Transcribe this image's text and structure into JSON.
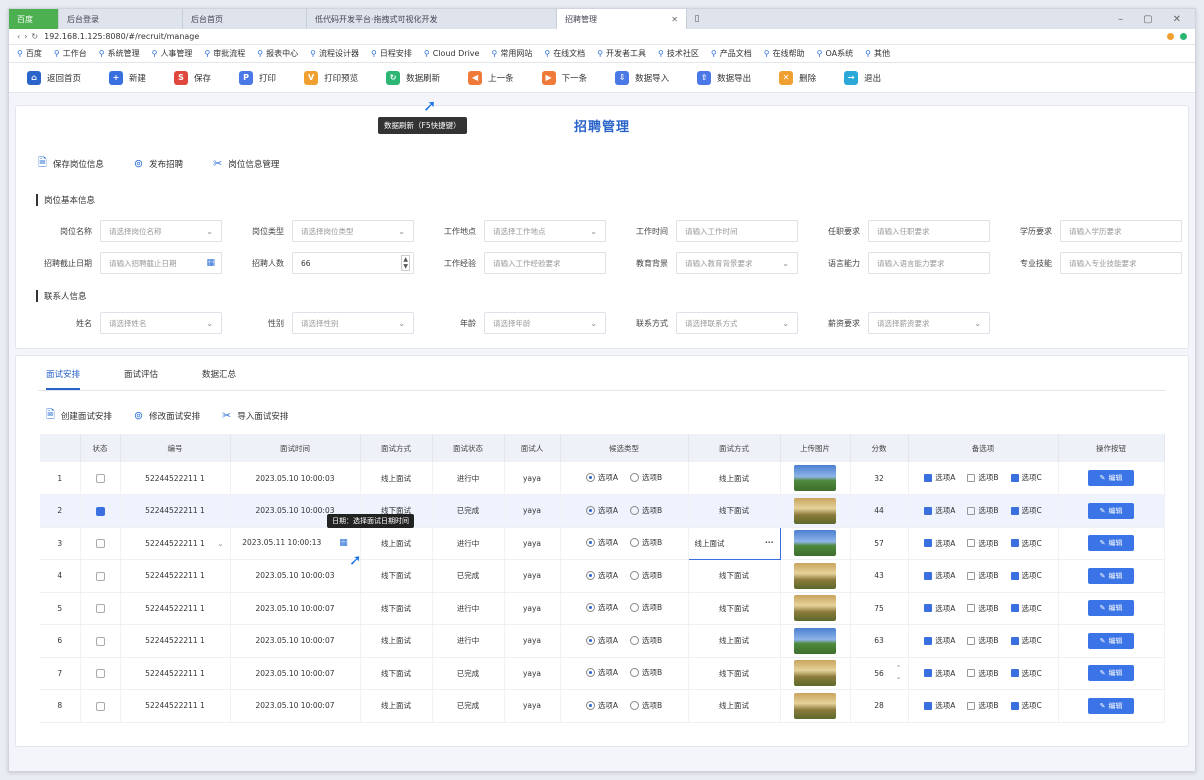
{
  "browser": {
    "tabs": [
      {
        "label": "百度",
        "cls": "first"
      },
      {
        "label": "后台登录",
        "cls": "w1"
      },
      {
        "label": "后台首页",
        "cls": "w2"
      },
      {
        "label": "低代码开发平台·拖拽式可视化开发",
        "cls": "w3"
      },
      {
        "label": "招聘管理",
        "cls": "active"
      }
    ],
    "url": "192.168.1.125:8080/#/recruit/manage",
    "bookmarks": [
      "百度",
      "工作台",
      "系统管理",
      "人事管理",
      "审批流程",
      "报表中心",
      "流程设计器",
      "日程安排",
      "Cloud Drive",
      "常用网站",
      "在线文档",
      "开发者工具",
      "技术社区",
      "产品文档",
      "在线帮助",
      "OA系统",
      "其他"
    ]
  },
  "toolbar": {
    "items": [
      {
        "label": "返回首页",
        "color": "#2a63c9",
        "glyph": "⌂",
        "name": "home"
      },
      {
        "label": "新建",
        "color": "#3a6fe0",
        "glyph": "+",
        "name": "new"
      },
      {
        "label": "保存",
        "color": "#e0483e",
        "glyph": "S",
        "name": "save"
      },
      {
        "label": "打印",
        "color": "#4a78e6",
        "glyph": "P",
        "name": "print"
      },
      {
        "label": "打印预览",
        "color": "#f0a030",
        "glyph": "V",
        "name": "preview"
      },
      {
        "label": "数据刷新",
        "color": "#2bb673",
        "glyph": "↻",
        "name": "refresh"
      },
      {
        "label": "上一条",
        "color": "#f07a3a",
        "glyph": "◀",
        "name": "prev"
      },
      {
        "label": "下一条",
        "color": "#f07a3a",
        "glyph": "▶",
        "name": "next"
      },
      {
        "label": "数据导入",
        "color": "#4a78e6",
        "glyph": "⇩",
        "name": "import"
      },
      {
        "label": "数据导出",
        "color": "#4a78e6",
        "glyph": "⇧",
        "name": "export"
      },
      {
        "label": "删除",
        "color": "#f0a030",
        "glyph": "✕",
        "name": "delete"
      },
      {
        "label": "退出",
        "color": "#2aa8d8",
        "glyph": "→",
        "name": "exit"
      }
    ],
    "tooltip": "数据刷新（F5快捷键）"
  },
  "form": {
    "title": "招聘管理",
    "actions": [
      "保存岗位信息",
      "发布招聘",
      "岗位信息管理"
    ],
    "section1": "岗位基本信息",
    "row1": [
      {
        "label": "岗位名称",
        "value": "请选择岗位名称",
        "kind": "select"
      },
      {
        "label": "岗位类型",
        "value": "请选择岗位类型",
        "kind": "select"
      },
      {
        "label": "工作地点",
        "value": "请选择工作地点",
        "kind": "select"
      },
      {
        "label": "工作时间",
        "value": "请输入工作时间",
        "kind": "input"
      },
      {
        "label": "任职要求",
        "value": "请输入任职要求",
        "kind": "input"
      },
      {
        "label": "学历要求",
        "value": "请输入学历要求",
        "kind": "input"
      }
    ],
    "row2": [
      {
        "label": "招聘截止日期",
        "value": "请输入招聘截止日期",
        "kind": "date"
      },
      {
        "label": "招聘人数",
        "value": "66",
        "kind": "number"
      },
      {
        "label": "工作经验",
        "value": "请输入工作经验要求",
        "kind": "input"
      },
      {
        "label": "教育背景",
        "value": "请输入教育背景要求",
        "kind": "select"
      },
      {
        "label": "语言能力",
        "value": "请输入语言能力要求",
        "kind": "input"
      },
      {
        "label": "专业技能",
        "value": "请输入专业技能要求",
        "kind": "input"
      }
    ],
    "section2": "联系人信息",
    "row3": [
      {
        "label": "姓名",
        "value": "请选择姓名",
        "kind": "select"
      },
      {
        "label": "性别",
        "value": "请选择性别",
        "kind": "select"
      },
      {
        "label": "年龄",
        "value": "请选择年龄",
        "kind": "select"
      },
      {
        "label": "联系方式",
        "value": "请选择联系方式",
        "kind": "select"
      },
      {
        "label": "薪资要求",
        "value": "请选择薪资要求",
        "kind": "select"
      }
    ]
  },
  "table": {
    "tabs": [
      "面试安排",
      "面试评估",
      "数据汇总"
    ],
    "actions": [
      "创建面试安排",
      "修改面试安排",
      "导入面试安排"
    ],
    "columns": [
      "",
      "状态",
      "编号",
      "面试时间",
      "面试方式",
      "面试状态",
      "面试人",
      "候选类型",
      "面试方式",
      "上传图片",
      "分数",
      "备选项",
      "操作按钮"
    ],
    "rows": [
      {
        "idx": "1",
        "checked": false,
        "id": "52244522211 1",
        "time": "2023.05.10 10:00:03",
        "mode": "线上面试",
        "status": "进行中",
        "person": "yaya",
        "radio": "a",
        "mode2": "线上面试",
        "score": "32",
        "opts": [
          true,
          false,
          true
        ],
        "img": "a",
        "sel": false
      },
      {
        "idx": "2",
        "checked": true,
        "id": "52244522211 1",
        "time": "2023.05.10 10:00:03",
        "mode": "线下面试",
        "status": "已完成",
        "person": "yaya",
        "radio": "a",
        "mode2": "线下面试",
        "score": "44",
        "opts": [
          true,
          false,
          true
        ],
        "img": "b",
        "sel": true
      },
      {
        "idx": "3",
        "checked": false,
        "id": "52244522211 1",
        "time": "2023.05.11 10:00:13",
        "mode": "线上面试",
        "status": "进行中",
        "person": "yaya",
        "radio": "a",
        "mode2": "线上面试",
        "score": "57",
        "opts": [
          true,
          false,
          true
        ],
        "img": "a",
        "sel": false,
        "editing": true
      },
      {
        "idx": "4",
        "checked": false,
        "id": "52244522211 1",
        "time": "2023.05.10 10:00:03",
        "mode": "线下面试",
        "status": "已完成",
        "person": "yaya",
        "radio": "a",
        "mode2": "线下面试",
        "score": "43",
        "opts": [
          true,
          false,
          true
        ],
        "img": "b",
        "sel": false
      },
      {
        "idx": "5",
        "checked": false,
        "id": "52244522211 1",
        "time": "2023.05.10 10:00:07",
        "mode": "线下面试",
        "status": "进行中",
        "person": "yaya",
        "radio": "a",
        "mode2": "线下面试",
        "score": "75",
        "opts": [
          true,
          false,
          true
        ],
        "img": "b",
        "sel": false
      },
      {
        "idx": "6",
        "checked": false,
        "id": "52244522211 1",
        "time": "2023.05.10 10:00:07",
        "mode": "线上面试",
        "status": "进行中",
        "person": "yaya",
        "radio": "a",
        "mode2": "线上面试",
        "score": "63",
        "opts": [
          true,
          false,
          true
        ],
        "img": "a",
        "sel": false
      },
      {
        "idx": "7",
        "checked": false,
        "id": "52244522211 1",
        "time": "2023.05.10 10:00:07",
        "mode": "线下面试",
        "status": "已完成",
        "person": "yaya",
        "radio": "a",
        "mode2": "线下面试",
        "score": "56",
        "opts": [
          true,
          false,
          true
        ],
        "img": "b",
        "sel": false
      },
      {
        "idx": "8",
        "checked": false,
        "id": "52244522211 1",
        "time": "2023.05.10 10:00:07",
        "mode": "线上面试",
        "status": "已完成",
        "person": "yaya",
        "radio": "a",
        "mode2": "线上面试",
        "score": "28",
        "opts": [
          true,
          false,
          true
        ],
        "img": "b",
        "sel": false
      }
    ],
    "radio_labels": [
      "选项A",
      "选项B"
    ],
    "opt_labels": [
      "选项A",
      "选项B",
      "选项C"
    ],
    "edit_label": "编辑",
    "row_tooltip": "日期：选择面试日期时间"
  },
  "colors": {
    "accent": "#2a63c9",
    "button": "#3a74e6"
  }
}
